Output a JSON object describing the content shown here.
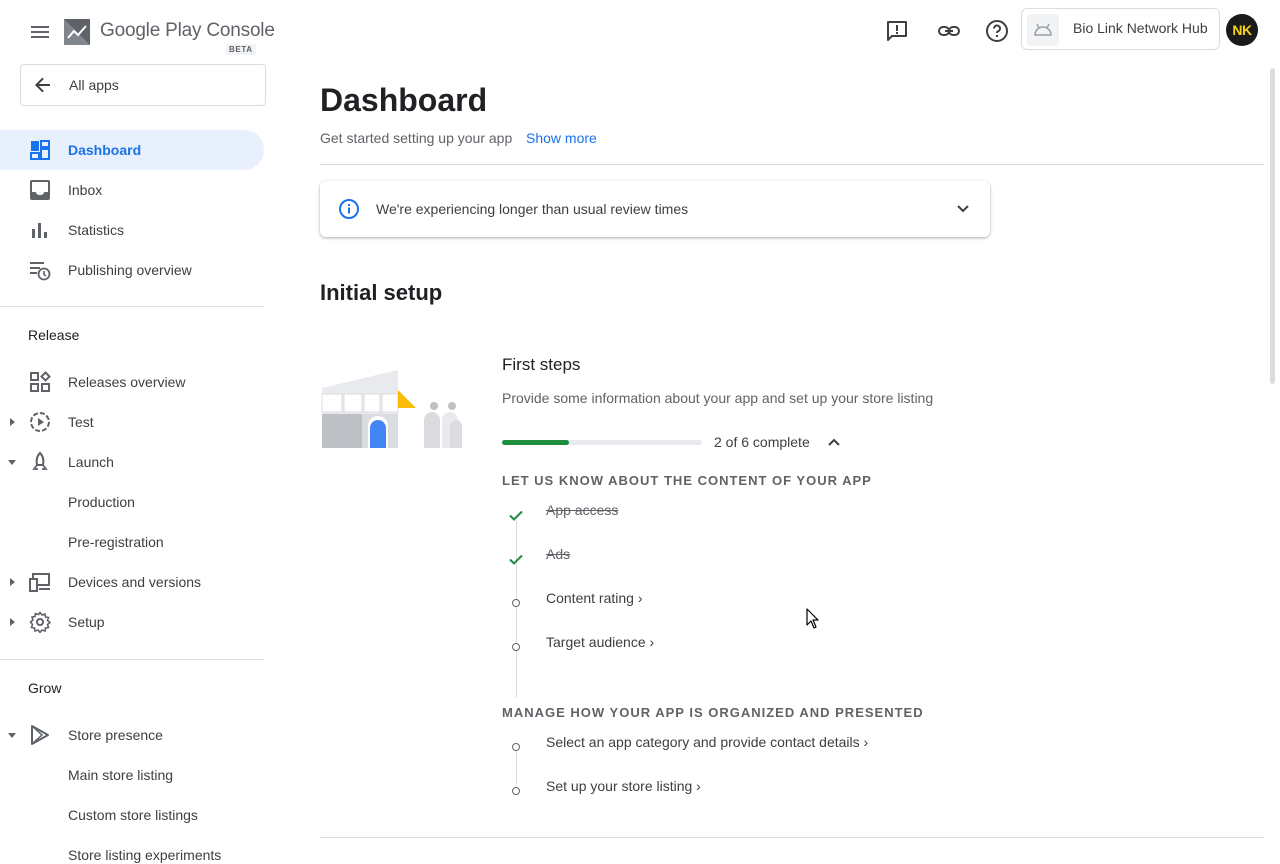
{
  "brand": {
    "name": "Google Play Console",
    "badge": "BETA"
  },
  "nav": {
    "all_apps": "All apps",
    "items": [
      {
        "label": "Dashboard",
        "icon": "dashboard-icon",
        "active": true
      },
      {
        "label": "Inbox",
        "icon": "inbox-icon"
      },
      {
        "label": "Statistics",
        "icon": "bar-chart-icon"
      },
      {
        "label": "Publishing overview",
        "icon": "publishing-overview-icon"
      }
    ],
    "release_section": "Release",
    "release_items": [
      {
        "label": "Releases overview",
        "icon": "releases-overview-icon"
      },
      {
        "label": "Test",
        "icon": "test-icon",
        "expander": "collapsed"
      },
      {
        "label": "Launch",
        "icon": "launch-icon",
        "expander": "expanded"
      },
      {
        "label": "Production"
      },
      {
        "label": "Pre-registration"
      },
      {
        "label": "Devices and versions",
        "icon": "devices-icon",
        "expander": "collapsed"
      },
      {
        "label": "Setup",
        "icon": "gear-icon",
        "expander": "collapsed"
      }
    ],
    "grow_section": "Grow",
    "grow_items": [
      {
        "label": "Store presence",
        "icon": "play-icon",
        "expander": "expanded"
      },
      {
        "label": "Main store listing"
      },
      {
        "label": "Custom store listings"
      },
      {
        "label": "Store listing experiments"
      }
    ]
  },
  "topbar": {
    "app_name": "Bio Link Network Hub",
    "avatar_initials": "NK"
  },
  "main": {
    "title": "Dashboard",
    "subtitle": "Get started setting up your app",
    "show_more": "Show more",
    "notice": "We're experiencing longer than usual review times",
    "section_title": "Initial setup",
    "steps_title": "First steps",
    "steps_desc": "Provide some information about your app and set up your store listing",
    "progress": {
      "done": 2,
      "total": 6,
      "label": "2 of 6 complete"
    },
    "groups": [
      {
        "title": "LET US KNOW ABOUT THE CONTENT OF YOUR APP",
        "tasks": [
          {
            "label": "App access",
            "done": true
          },
          {
            "label": "Ads",
            "done": true
          },
          {
            "label": "Content rating",
            "done": false
          },
          {
            "label": "Target audience",
            "done": false
          }
        ]
      },
      {
        "title": "MANAGE HOW YOUR APP IS ORGANIZED AND PRESENTED",
        "tasks": [
          {
            "label": "Select an app category and provide contact details",
            "done": false
          },
          {
            "label": "Set up your store listing",
            "done": false
          }
        ]
      }
    ]
  },
  "colors": {
    "accent": "#1a73e8",
    "active_bg": "#e8f0fe",
    "success": "#1e8e3e"
  }
}
